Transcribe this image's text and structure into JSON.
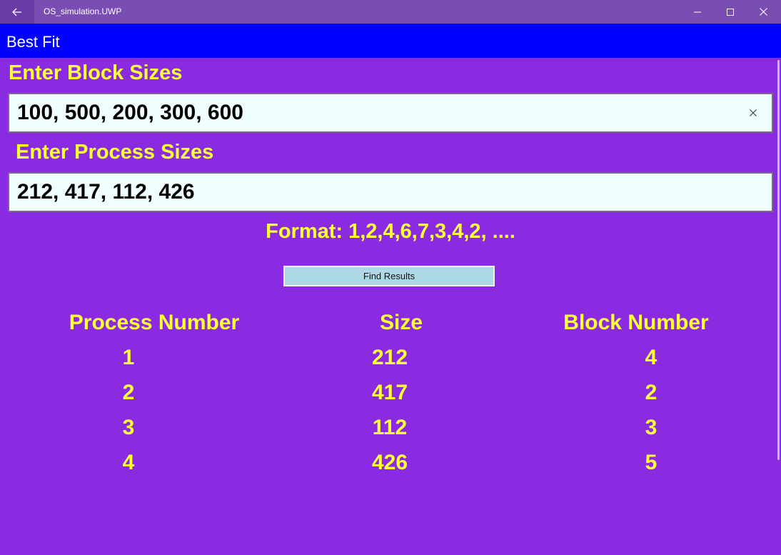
{
  "window": {
    "title": "OS_simulation.UWP"
  },
  "header": {
    "title": "Best Fit"
  },
  "form": {
    "block_label": "Enter Block Sizes",
    "block_value": "100, 500, 200, 300, 600",
    "process_label": "Enter Process Sizes",
    "process_value": "212, 417, 112, 426",
    "format_hint": "Format: 1,2,4,6,7,3,4,2, ....",
    "submit_label": "Find Results"
  },
  "results": {
    "columns": [
      "Process Number",
      "Size",
      "Block Number"
    ],
    "rows": [
      [
        "1",
        "212",
        "4"
      ],
      [
        "2",
        "417",
        "2"
      ],
      [
        "3",
        "112",
        "3"
      ],
      [
        "4",
        "426",
        "5"
      ]
    ]
  },
  "icons": {
    "back": "back-arrow-icon",
    "minimize": "minimize-icon",
    "maximize": "maximize-icon",
    "close": "close-icon",
    "clear": "clear-icon"
  },
  "colors": {
    "background": "#8a2be2",
    "header": "#0000ff",
    "label": "#ffff33",
    "button": "#add8e6",
    "input": "#f0fffe"
  }
}
